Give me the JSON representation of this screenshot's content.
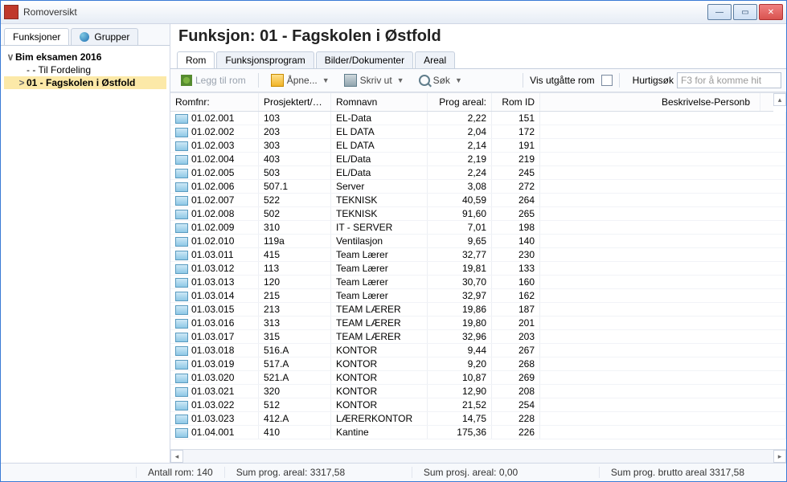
{
  "window_title": "Romoversikt",
  "left_tabs": [
    "Funksjoner",
    "Grupper"
  ],
  "tree": {
    "root_expander": "∨",
    "root": "Bim eksamen 2016",
    "child1": "- - Til Fordeling",
    "child2_expander": ">",
    "child2": "01 - Fagskolen i Østfold"
  },
  "header": "Funksjon: 01 - Fagskolen i Østfold",
  "main_tabs": [
    "Rom",
    "Funksjonsprogram",
    "Bilder/Dokumenter",
    "Areal"
  ],
  "toolbar": {
    "add": "Legg til rom",
    "open": "Åpne...",
    "print": "Skriv ut",
    "search": "Søk",
    "show_expired": "Vis utgåtte rom",
    "quicksearch_label": "Hurtigsøk",
    "quicksearch_placeholder": "F3 for å komme hit"
  },
  "columns": {
    "c1": "Romfnr:",
    "c2": "Prosjektert/Ge...",
    "c3": "Romnavn",
    "c4": "Prog areal:",
    "c5": "Rom ID",
    "c6": "Beskrivelse-Personb"
  },
  "rows": [
    {
      "rf": "01.02.001",
      "pg": "103",
      "rn": "EL-Data",
      "pa": "2,22",
      "id": "151"
    },
    {
      "rf": "01.02.002",
      "pg": "203",
      "rn": "EL DATA",
      "pa": "2,04",
      "id": "172"
    },
    {
      "rf": "01.02.003",
      "pg": "303",
      "rn": "EL DATA",
      "pa": "2,14",
      "id": "191"
    },
    {
      "rf": "01.02.004",
      "pg": "403",
      "rn": "EL/Data",
      "pa": "2,19",
      "id": "219"
    },
    {
      "rf": "01.02.005",
      "pg": "503",
      "rn": "EL/Data",
      "pa": "2,24",
      "id": "245"
    },
    {
      "rf": "01.02.006",
      "pg": "507.1",
      "rn": "Server",
      "pa": "3,08",
      "id": "272"
    },
    {
      "rf": "01.02.007",
      "pg": "522",
      "rn": "TEKNISK",
      "pa": "40,59",
      "id": "264"
    },
    {
      "rf": "01.02.008",
      "pg": "502",
      "rn": "TEKNISK",
      "pa": "91,60",
      "id": "265"
    },
    {
      "rf": "01.02.009",
      "pg": "310",
      "rn": "IT - SERVER",
      "pa": "7,01",
      "id": "198"
    },
    {
      "rf": "01.02.010",
      "pg": "119a",
      "rn": "Ventilasjon",
      "pa": "9,65",
      "id": "140"
    },
    {
      "rf": "01.03.011",
      "pg": "415",
      "rn": "Team Lærer",
      "pa": "32,77",
      "id": "230"
    },
    {
      "rf": "01.03.012",
      "pg": "113",
      "rn": "Team Lærer",
      "pa": "19,81",
      "id": "133"
    },
    {
      "rf": "01.03.013",
      "pg": "120",
      "rn": "Team Lærer",
      "pa": "30,70",
      "id": "160"
    },
    {
      "rf": "01.03.014",
      "pg": "215",
      "rn": "Team Lærer",
      "pa": "32,97",
      "id": "162"
    },
    {
      "rf": "01.03.015",
      "pg": "213",
      "rn": "TEAM LÆRER",
      "pa": "19,86",
      "id": "187"
    },
    {
      "rf": "01.03.016",
      "pg": "313",
      "rn": "TEAM LÆRER",
      "pa": "19,80",
      "id": "201"
    },
    {
      "rf": "01.03.017",
      "pg": "315",
      "rn": "TEAM LÆRER",
      "pa": "32,96",
      "id": "203"
    },
    {
      "rf": "01.03.018",
      "pg": "516.A",
      "rn": "KONTOR",
      "pa": "9,44",
      "id": "267"
    },
    {
      "rf": "01.03.019",
      "pg": "517.A",
      "rn": "KONTOR",
      "pa": "9,20",
      "id": "268"
    },
    {
      "rf": "01.03.020",
      "pg": "521.A",
      "rn": "KONTOR",
      "pa": "10,87",
      "id": "269"
    },
    {
      "rf": "01.03.021",
      "pg": "320",
      "rn": "KONTOR",
      "pa": "12,90",
      "id": "208"
    },
    {
      "rf": "01.03.022",
      "pg": "512",
      "rn": "KONTOR",
      "pa": "21,52",
      "id": "254"
    },
    {
      "rf": "01.03.023",
      "pg": "412.A",
      "rn": "LÆRERKONTOR",
      "pa": "14,75",
      "id": "228"
    },
    {
      "rf": "01.04.001",
      "pg": "410",
      "rn": "Kantine",
      "pa": "175,36",
      "id": "226"
    }
  ],
  "status": {
    "count": "Antall rom: 140",
    "sum_prog": "Sum prog. areal: 3317,58",
    "sum_prosj": "Sum prosj. areal: 0,00",
    "sum_brutto": "Sum prog. brutto areal 3317,58"
  }
}
